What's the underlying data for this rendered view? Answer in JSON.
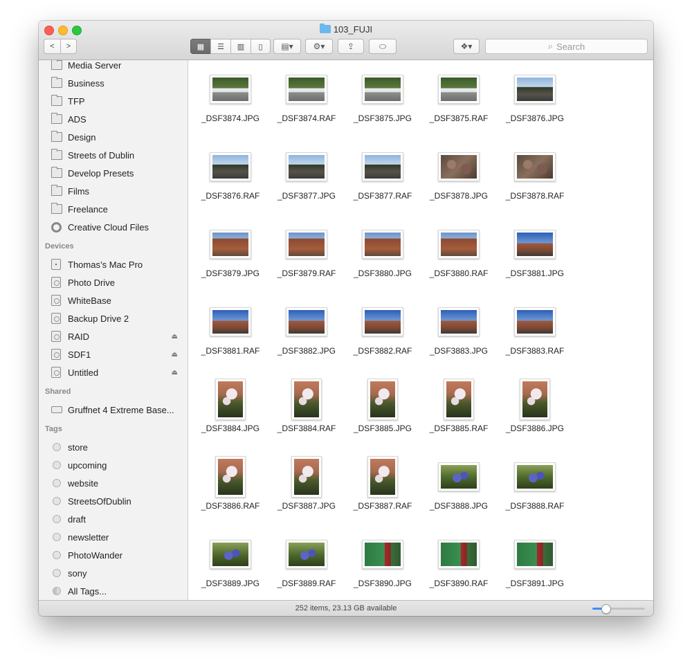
{
  "window": {
    "title": "103_FUJI"
  },
  "toolbar": {
    "back": "<",
    "forward": ">",
    "views": [
      {
        "name": "icon-view",
        "glyph": "▦",
        "active": true
      },
      {
        "name": "list-view",
        "glyph": "☰",
        "active": false
      },
      {
        "name": "column-view",
        "glyph": "▥",
        "active": false
      },
      {
        "name": "coverflow-view",
        "glyph": "▯",
        "active": false
      }
    ],
    "arrange_glyph": "▤▾",
    "action_glyph": "⚙▾",
    "share_glyph": "⇪",
    "tag_glyph": "⬭",
    "dropbox_glyph": "❖▾",
    "search_placeholder": "Search"
  },
  "sidebar": {
    "favorites": [
      {
        "label": "Media Server",
        "icon": "folder-icon"
      },
      {
        "label": "Business",
        "icon": "folder-icon"
      },
      {
        "label": "TFP",
        "icon": "folder-icon"
      },
      {
        "label": "ADS",
        "icon": "folder-icon"
      },
      {
        "label": "Design",
        "icon": "folder-icon"
      },
      {
        "label": "Streets of Dublin",
        "icon": "folder-icon"
      },
      {
        "label": "Develop Presets",
        "icon": "folder-icon"
      },
      {
        "label": "Films",
        "icon": "folder-icon"
      },
      {
        "label": "Freelance",
        "icon": "folder-icon"
      },
      {
        "label": "Creative Cloud Files",
        "icon": "creative-cloud-icon"
      }
    ],
    "devices_header": "Devices",
    "devices": [
      {
        "label": "Thomas’s Mac Pro",
        "icon": "computer-icon",
        "eject": false
      },
      {
        "label": "Photo Drive",
        "icon": "disk-icon",
        "eject": false
      },
      {
        "label": "WhiteBase",
        "icon": "disk-icon",
        "eject": false
      },
      {
        "label": "Backup Drive 2",
        "icon": "disk-icon",
        "eject": false
      },
      {
        "label": "RAID",
        "icon": "disk-icon",
        "eject": true
      },
      {
        "label": "SDF1",
        "icon": "disk-icon",
        "eject": true
      },
      {
        "label": "Untitled",
        "icon": "disk-icon",
        "eject": true
      }
    ],
    "shared_header": "Shared",
    "shared": [
      {
        "label": "Gruffnet 4 Extreme Base...",
        "icon": "network-icon"
      }
    ],
    "tags_header": "Tags",
    "tags": [
      {
        "label": "store"
      },
      {
        "label": "upcoming"
      },
      {
        "label": "website"
      },
      {
        "label": "StreetsOfDublin"
      },
      {
        "label": "draft"
      },
      {
        "label": "newsletter"
      },
      {
        "label": "PhotoWander"
      },
      {
        "label": "sony"
      },
      {
        "label": "All Tags..."
      }
    ],
    "eject_glyph": "⏏"
  },
  "files": [
    {
      "name": "_DSF3874.JPG",
      "kind": "car"
    },
    {
      "name": "_DSF3874.RAF",
      "kind": "car"
    },
    {
      "name": "_DSF3875.JPG",
      "kind": "car"
    },
    {
      "name": "_DSF3875.RAF",
      "kind": "car"
    },
    {
      "name": "_DSF3876.JPG",
      "kind": "street"
    },
    {
      "name": "_DSF3876.RAF",
      "kind": "street"
    },
    {
      "name": "_DSF3877.JPG",
      "kind": "street"
    },
    {
      "name": "_DSF3877.RAF",
      "kind": "street"
    },
    {
      "name": "_DSF3878.JPG",
      "kind": "leaves"
    },
    {
      "name": "_DSF3878.RAF",
      "kind": "leaves"
    },
    {
      "name": "_DSF3879.JPG",
      "kind": "brick"
    },
    {
      "name": "_DSF3879.RAF",
      "kind": "brick"
    },
    {
      "name": "_DSF3880.JPG",
      "kind": "brick"
    },
    {
      "name": "_DSF3880.RAF",
      "kind": "brick"
    },
    {
      "name": "_DSF3881.JPG",
      "kind": "skyrow"
    },
    {
      "name": "_DSF3881.RAF",
      "kind": "skyrow"
    },
    {
      "name": "_DSF3882.JPG",
      "kind": "skyrow"
    },
    {
      "name": "_DSF3882.RAF",
      "kind": "skyrow"
    },
    {
      "name": "_DSF3883.JPG",
      "kind": "skyrow"
    },
    {
      "name": "_DSF3883.RAF",
      "kind": "skyrow"
    },
    {
      "name": "_DSF3884.JPG",
      "kind": "blossom"
    },
    {
      "name": "_DSF3884.RAF",
      "kind": "blossom"
    },
    {
      "name": "_DSF3885.JPG",
      "kind": "blossom"
    },
    {
      "name": "_DSF3885.RAF",
      "kind": "blossom"
    },
    {
      "name": "_DSF3886.JPG",
      "kind": "blossom"
    },
    {
      "name": "_DSF3886.RAF",
      "kind": "blossom"
    },
    {
      "name": "_DSF3887.JPG",
      "kind": "blossom"
    },
    {
      "name": "_DSF3887.RAF",
      "kind": "blossom"
    },
    {
      "name": "_DSF3888.JPG",
      "kind": "bluebell"
    },
    {
      "name": "_DSF3888.RAF",
      "kind": "bluebell"
    },
    {
      "name": "_DSF3889.JPG",
      "kind": "bluebell"
    },
    {
      "name": "_DSF3889.RAF",
      "kind": "bluebell"
    },
    {
      "name": "_DSF3890.JPG",
      "kind": "green"
    },
    {
      "name": "_DSF3890.RAF",
      "kind": "green"
    },
    {
      "name": "_DSF3891.JPG",
      "kind": "green"
    }
  ],
  "thumb_styles": {
    "car": "linear-gradient(180deg,#3c5a2c 0%,#5b7a3a 45%,#e8ecef 46%,#dfe3e6 62%,#8d8f8c 63%,#6d6e6b 100%)",
    "street": "linear-gradient(180deg,#8fb4de 0%,#c3d6ea 40%,#2f3a28 41%,#56524a 70%,#3b3b3a 100%)",
    "leaves": "radial-gradient(circle at 30% 40%,#9c7a6b 0 15%,transparent 16%),radial-gradient(circle at 70% 60%,#7d5a52 0 18%,transparent 19%),linear-gradient(135deg,#5a4a3e,#8a6f5c 50%,#4a3b32)",
    "brick": "linear-gradient(180deg,#6b93c9 0%,#8fb0d6 25%,#8a4b33 26%,#a55c3b 70%,#5f4a3c 100%)",
    "skyrow": "linear-gradient(180deg,#2c5fb6 0%,#6e98d6 45%,#a0573c 46%,#7e4a34 75%,#3d3a37 100%)",
    "blossom": "radial-gradient(circle at 55% 35%,#f1e9ee 0 20%,transparent 21%),radial-gradient(circle at 35% 55%,#e7dbe2 0 15%,transparent 16%),linear-gradient(180deg,#c07a5c 0%,#a86a4f 35%,#4a5a2c 60%,#28331c 100%)",
    "bluebell": "radial-gradient(circle at 45% 55%,#5c63c8 0 18%,transparent 19%),radial-gradient(circle at 65% 45%,#4c54b8 0 14%,transparent 15%),linear-gradient(180deg,#8aa05a 0%,#4f6a2c 50%,#2f3f1c 100%)",
    "green": "linear-gradient(90deg,#2e7a43 0%,#3a8f52 55%,#a52a2a 56%,#8b2424 72%,#3d6b3b 73%,#2e5a30 100%)"
  },
  "status": {
    "text": "252 items, 23.13 GB available",
    "zoom_level": 0.25
  }
}
